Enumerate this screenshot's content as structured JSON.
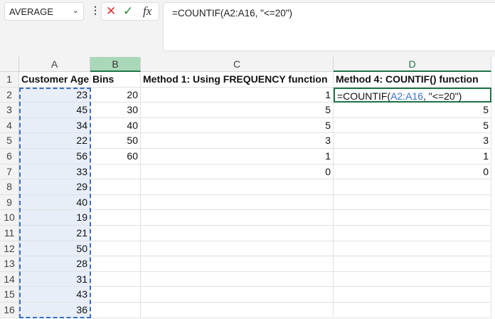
{
  "name_box": {
    "value": "AVERAGE"
  },
  "formula_bar": {
    "value": "=COUNTIF(A2:A16, \"<=20\")",
    "cancel_icon": "x-icon",
    "enter_icon": "check-icon",
    "fx_label": "fx"
  },
  "columns": [
    "A",
    "B",
    "C",
    "D"
  ],
  "rows": [
    "1",
    "2",
    "3",
    "4",
    "5",
    "6",
    "7",
    "8",
    "9",
    "10",
    "11",
    "12",
    "13",
    "14",
    "15",
    "16"
  ],
  "headers": {
    "A": "Customer Age",
    "B": "Bins",
    "C": "Method 1: Using FREQUENCY function",
    "D": "Method 4: COUNTIF() function"
  },
  "col_a": [
    "23",
    "45",
    "34",
    "22",
    "56",
    "33",
    "29",
    "40",
    "19",
    "21",
    "50",
    "28",
    "31",
    "43",
    "36"
  ],
  "col_b": [
    "20",
    "30",
    "40",
    "50",
    "60"
  ],
  "col_c": [
    "1",
    "5",
    "5",
    "3",
    "1",
    "0"
  ],
  "col_d_edit": {
    "prefix": "=COUNTIF(",
    "ref": "A2:A16",
    "suffix": ", \"<=20\")"
  },
  "col_d": [
    "5",
    "5",
    "3",
    "1",
    "0"
  ],
  "colors": {
    "accent": "#217346",
    "ref": "#3a6fc4"
  }
}
